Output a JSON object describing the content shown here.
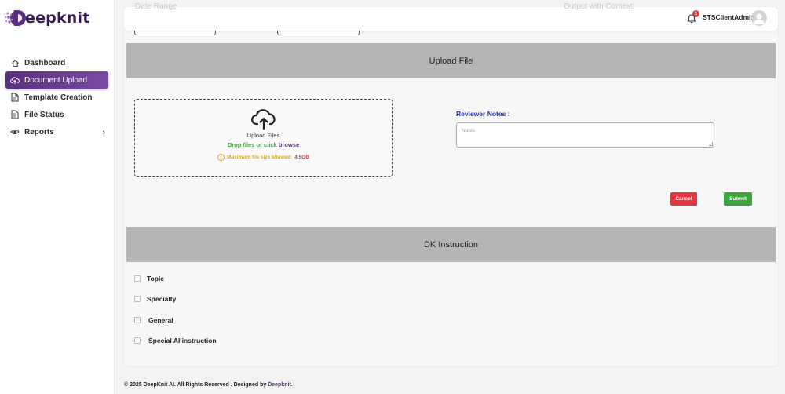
{
  "brand": {
    "name": "eepknit",
    "accent": "#5a2f7e"
  },
  "sidebar": {
    "items": [
      {
        "label": "Dashboard",
        "icon": "home-icon"
      },
      {
        "label": "Document Upload",
        "icon": "cloud-upload-icon",
        "active": true
      },
      {
        "label": "Template Creation",
        "icon": "document-icon"
      },
      {
        "label": "File Status",
        "icon": "file-list-icon"
      },
      {
        "label": "Reports",
        "icon": "eye-icon",
        "chevron": "›"
      }
    ]
  },
  "header": {
    "ghost_left": "Date Range",
    "ghost_right": "Output with Context:",
    "notification_count": "1",
    "username": "STSClientAdmin"
  },
  "upload": {
    "section_title": "Upload File",
    "dropzone_title": "Upload Files",
    "drop_text": "Drop files or click",
    "browse_text": "browse",
    "max_text": "Maximum file size allowed:",
    "max_size": "4.5GB",
    "reviewer_label": "Reviewer Notes :",
    "notes_placeholder": "Notes",
    "cancel_label": "Cancel",
    "submit_label": "Submit"
  },
  "instructions": {
    "section_title": "DK Instruction",
    "options": [
      "Topic",
      "Specialty",
      "General",
      "Special AI instruction"
    ]
  },
  "footer": {
    "text": "© 2025 DeepKnit AI. All Rights Reserved . Designed",
    "by": "by",
    "link": "Deepknit."
  }
}
